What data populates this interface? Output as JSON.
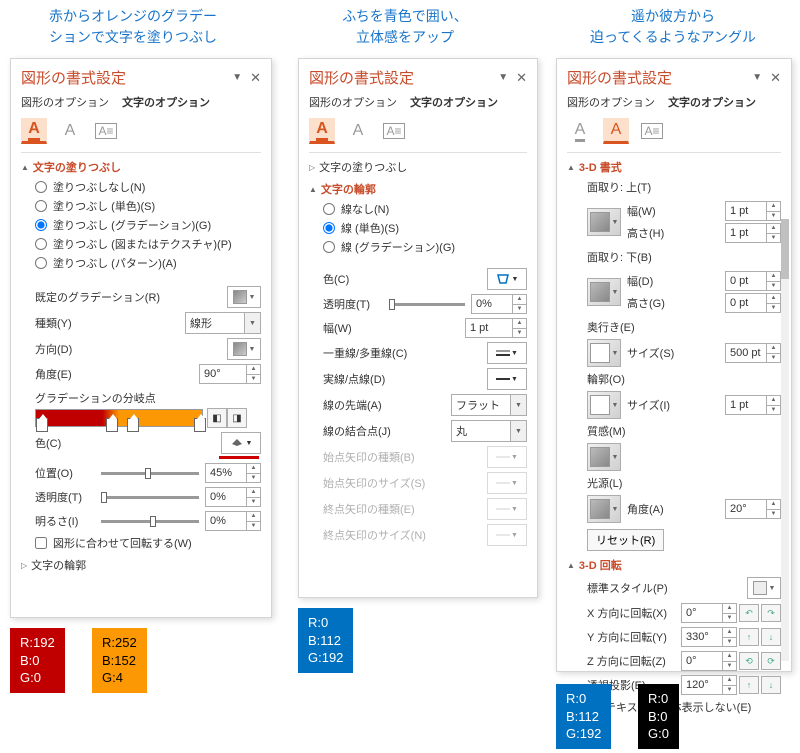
{
  "captions": {
    "left": "赤からオレンジのグラデー\nションで文字を塗りつぶし",
    "mid": "ふちを青色で囲い、\n立体感をアップ",
    "right": "遥か彼方から\n迫ってくるようなアングル"
  },
  "panel": {
    "title": "図形の書式設定",
    "tab_shape": "図形のオプション",
    "tab_text": "文字のオプション"
  },
  "sections": {
    "fill": "文字の塗りつぶし",
    "outline": "文字の輪郭",
    "fmt3d": "3-D 書式",
    "rot3d": "3-D 回転"
  },
  "radios": {
    "nofill": "塗りつぶしなし(N)",
    "solid": "塗りつぶし (単色)(S)",
    "grad": "塗りつぶし (グラデーション)(G)",
    "pict": "塗りつぶし (図またはテクスチャ)(P)",
    "patt": "塗りつぶし (パターン)(A)",
    "noline": "線なし(N)",
    "lsolid": "線 (単色)(S)",
    "lgrad": "線 (グラデーション)(G)"
  },
  "labels": {
    "preset": "既定のグラデーション(R)",
    "type": "種類(Y)",
    "dir": "方向(D)",
    "angle": "角度(E)",
    "stops": "グラデーションの分岐点",
    "color": "色(C)",
    "pos": "位置(O)",
    "trans": "透明度(T)",
    "bright": "明るさ(I)",
    "rotwith": "図形に合わせて回転する(W)",
    "width": "幅(W)",
    "compound": "一重線/多重線(C)",
    "dash": "実線/点線(D)",
    "cap": "線の先端(A)",
    "join": "線の結合点(J)",
    "arrbeg": "始点矢印の種類(B)",
    "arrbegsize": "始点矢印のサイズ(S)",
    "arrend": "終点矢印の種類(E)",
    "arrendsize": "終点矢印のサイズ(N)",
    "bevtop": "面取り: 上(T)",
    "bevbot": "面取り: 下(B)",
    "depth": "奥行き(E)",
    "contour": "輪郭(O)",
    "material": "質感(M)",
    "light": "光源(L)",
    "w": "幅(W)",
    "h": "高さ(H)",
    "wd": "幅(D)",
    "hg": "高さ(G)",
    "sizes": "サイズ(S)",
    "sizei": "サイズ(I)",
    "anglea": "角度(A)",
    "reset": "リセット(R)",
    "preset3d": "標準スタイル(P)",
    "rx": "X 方向に回転(X)",
    "ry": "Y 方向に回転(Y)",
    "rz": "Z 方向に回転(Z)",
    "persp": "透視投影(E)",
    "flat": "テキストを立体表示しない(E)"
  },
  "values": {
    "type": "線形",
    "angle": "90°",
    "pos": "45%",
    "trans": "0%",
    "bright": "0%",
    "width_line": "1 pt",
    "cap": "フラット",
    "join": "丸",
    "bev_w": "1 pt",
    "bev_h": "1 pt",
    "bev_wd": "0 pt",
    "bev_hg": "0 pt",
    "size_s": "500 pt",
    "size_i": "1 pt",
    "angle_a": "20°",
    "rx": "0°",
    "ry": "330°",
    "rz": "0°",
    "persp": "120°"
  },
  "colorboxes": {
    "red": "R:192\nB:0\nG:0",
    "orange": "R:252\nB:152\nG:4",
    "blue": "R:0\nB:112\nG:192",
    "black": "R:0\nB:0\nG:0"
  }
}
